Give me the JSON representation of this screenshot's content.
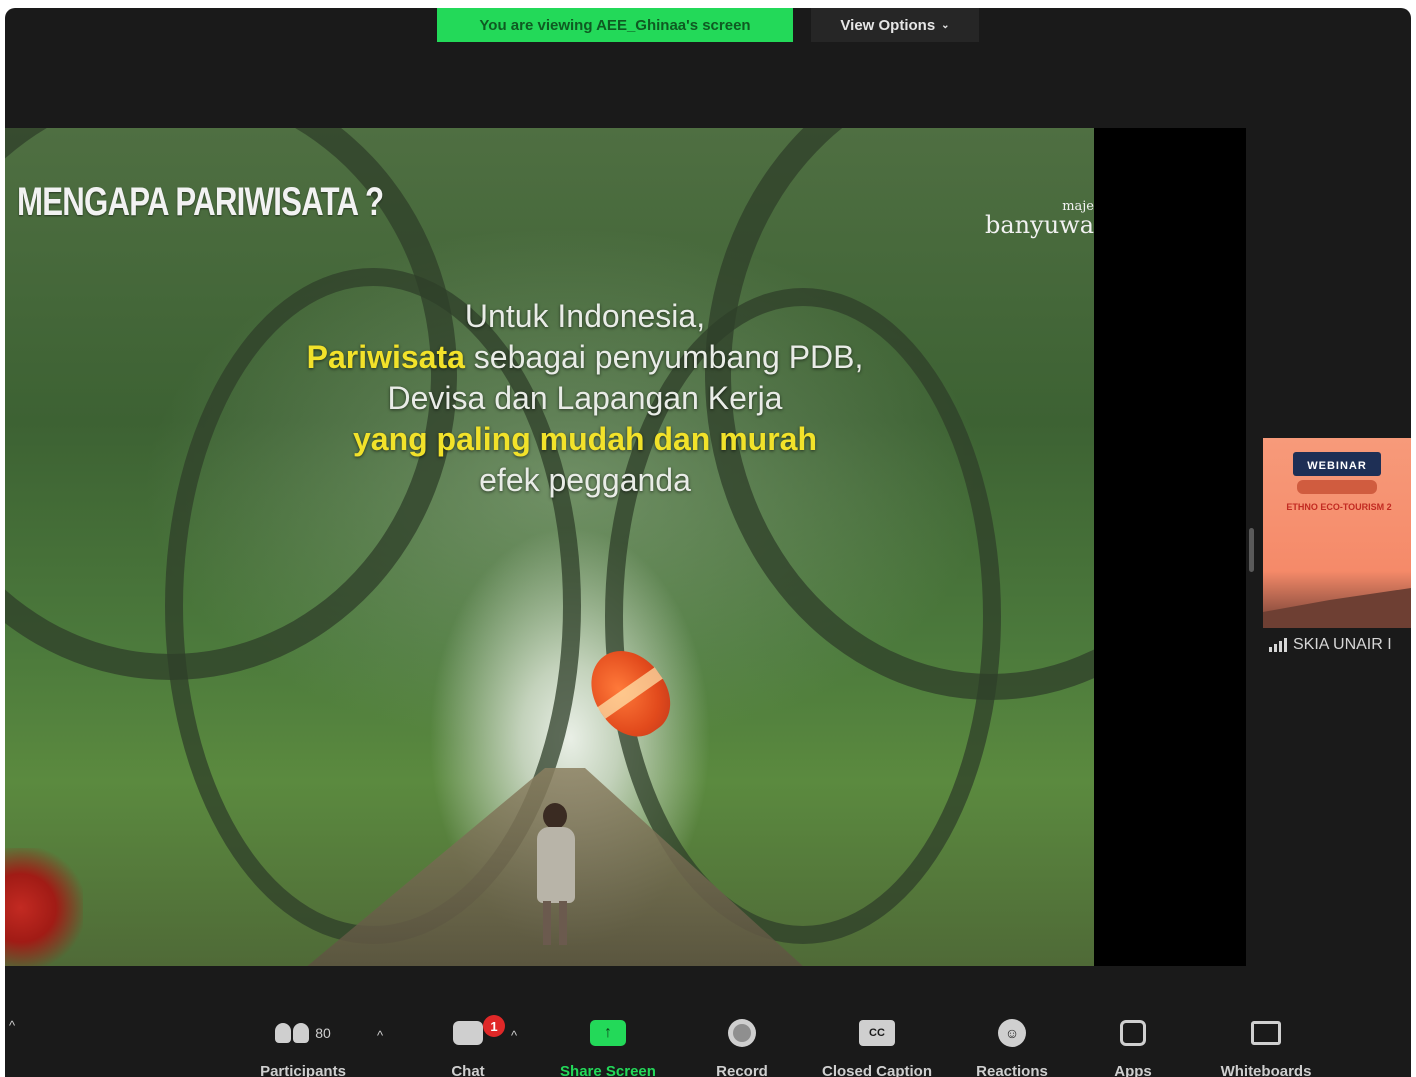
{
  "banner": {
    "text": "You are viewing AEE_Ghinaa's screen"
  },
  "view_options": {
    "label": "View Options",
    "chevron": "⌄"
  },
  "slide": {
    "title": "MENGAPA PARIWISATA ?",
    "logo_top": "maje",
    "logo_bottom": "banyuwa",
    "lines": {
      "l1": "Untuk Indonesia,",
      "l2_highlight": "Pariwisata",
      "l2_rest": " sebagai penyumbang PDB,",
      "l3": "Devisa dan Lapangan Kerja",
      "l4_highlight": "yang paling mudah dan murah",
      "l5": "efek pegganda"
    }
  },
  "thumbnail": {
    "webinar": "WEBINAR",
    "subtitle": "ETHNO ECO-TOURISM 2",
    "name": "SKIA UNAIR I"
  },
  "toolbar": {
    "caret": "^",
    "participants": {
      "label": "Participants",
      "count": "80",
      "icon": "people-icon"
    },
    "chat": {
      "label": "Chat",
      "badge": "1",
      "icon": "chat-icon"
    },
    "share_screen": {
      "label": "Share Screen",
      "icon": "share-screen-icon",
      "arrow": "↑"
    },
    "record": {
      "label": "Record",
      "icon": "record-icon"
    },
    "closed_caption": {
      "label": "Closed Caption",
      "icon": "cc-icon",
      "cc": "CC"
    },
    "reactions": {
      "label": "Reactions",
      "icon": "reaction-icon",
      "face": "☺"
    },
    "apps": {
      "label": "Apps",
      "icon": "apps-icon"
    },
    "whiteboards": {
      "label": "Whiteboards",
      "icon": "whiteboard-icon"
    }
  },
  "colors": {
    "accent_green": "#23d959",
    "badge_red": "#e02828",
    "highlight_yellow": "#f2e22a"
  }
}
